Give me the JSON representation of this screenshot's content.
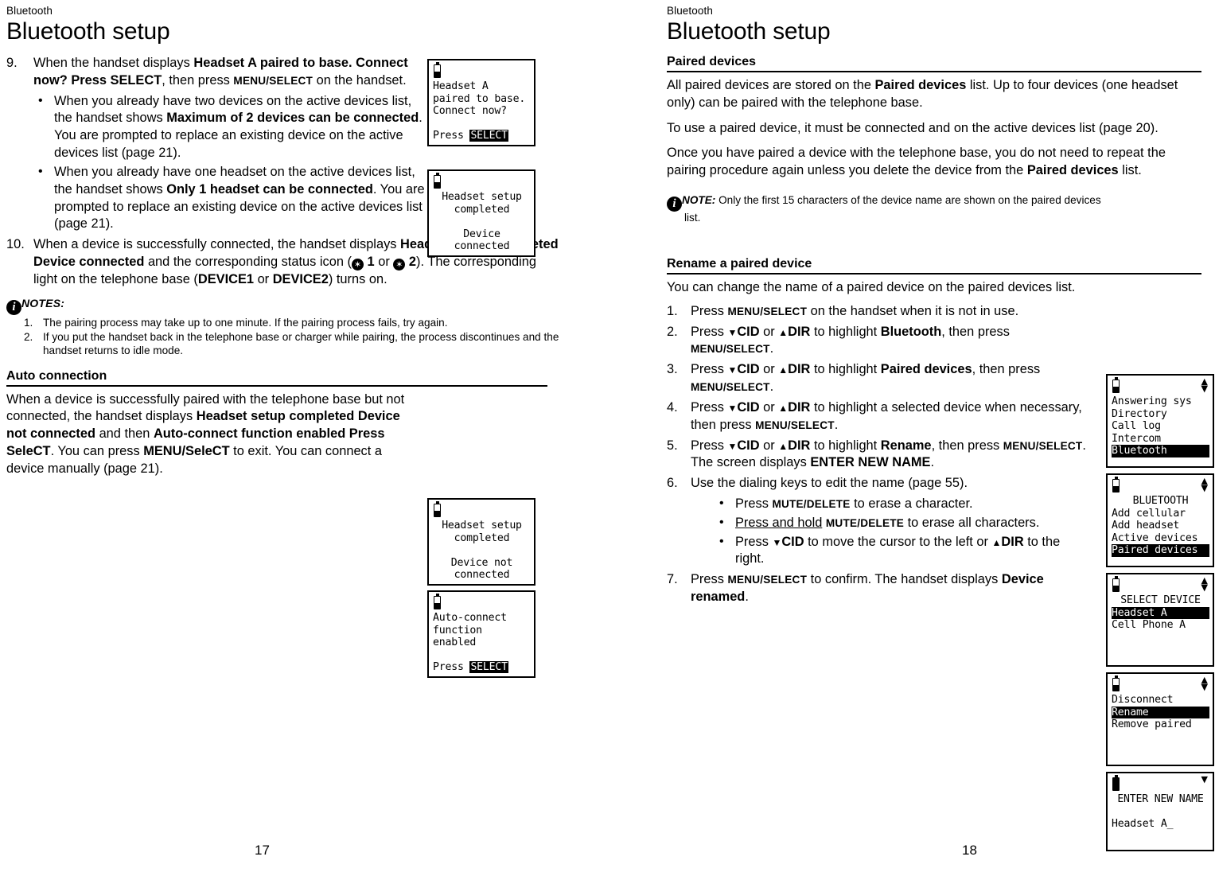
{
  "left_page": {
    "running_head": "Bluetooth",
    "chapter_title": "Bluetooth setup",
    "step9": {
      "num": "9.",
      "t1": "When the handset displays ",
      "b1": "Headset A paired to base. Connect now? Press SELECT",
      "t2": ", then press ",
      "sc1": "MENU/SELECT",
      "t3": " on the handset.",
      "bullets": [
        {
          "t1": "When you already have two devices on the active devices list, the handset shows ",
          "b1": "Maximum of 2 devices can be connected",
          "t2": ". You are prompted to replace an existing device on the active devices list (page 21)."
        },
        {
          "t1": "When you already have one headset on the active devices list, the handset shows ",
          "b1": "Only 1 headset can be connected",
          "t2": ". You are prompted to replace an existing device on the active devices list (page 21)."
        }
      ]
    },
    "step10": {
      "num": "10.",
      "t1": "When a device is successfully connected, the handset displays ",
      "b1": "Headset setup completed Device connected",
      "t2": " and the corresponding status icon (",
      "icon1_num": "1",
      "t3": " or ",
      "icon2_num": "2",
      "t4": "). The corresponding light on the telephone base (",
      "b2": "DEVICE1",
      "t5": " or ",
      "b3": "DEVICE2",
      "t6": ") turns on."
    },
    "notes": {
      "icon": "info-icon",
      "label": "NOTES:",
      "items": [
        {
          "num": "1.",
          "text": "The pairing process may take up to one minute. If the pairing process fails, try again."
        },
        {
          "num": "2.",
          "text": "If you put the handset back in the telephone base or charger while pairing, the process discontinues and the handset returns to idle mode."
        }
      ]
    },
    "auto_connection": {
      "heading": "Auto connection",
      "t1": "When a device is successfully paired with the telephone base but not connected, the handset displays ",
      "b1": "Headset setup completed Device not connected",
      "t2": " and then ",
      "b2": "Auto-connect function enabled Press SeleCT",
      "t3": ". You can press ",
      "b3": "MENU/SeleCT",
      "t4": " to exit. You can connect a device manually (page 21)."
    },
    "page_number": "17",
    "lcds": [
      {
        "name": "lcd-headset-paired",
        "rows": [
          "Headset A",
          "paired to base.",
          "Connect now?",
          "",
          "Press ",
          "SELECT"
        ],
        "line1": "Headset A",
        "line2": "paired to base.",
        "line3": "Connect now?",
        "line5_plain": "Press ",
        "line5_inv": "SELECT"
      },
      {
        "name": "lcd-setup-completed-connected",
        "line1": "Headset setup",
        "line2": "completed",
        "line4": "Device",
        "line5": "connected"
      },
      {
        "name": "lcd-setup-completed-not-connected",
        "line1": "Headset setup",
        "line2": "completed",
        "line4": "Device not",
        "line5": "connected"
      },
      {
        "name": "lcd-auto-connect-enabled",
        "line1": "Auto-connect",
        "line2": "function",
        "line3": "enabled",
        "line5_plain": "Press ",
        "line5_inv": "SELECT"
      }
    ]
  },
  "right_page": {
    "running_head": "Bluetooth",
    "chapter_title": "Bluetooth setup",
    "paired_devices": {
      "heading": "Paired devices",
      "p1_t1": "All paired devices are stored on the ",
      "p1_b1": "Paired devices",
      "p1_t2": " list. Up to four devices (one headset only) can be paired with the telephone base.",
      "p2": "To use a paired device, it must be connected and on the active devices list (page 20).",
      "p3_t1": "Once you have paired a device with the telephone base, you do not need to repeat the pairing procedure again unless you delete the device from the ",
      "p3_b1": "Paired devices",
      "p3_t2": " list.",
      "note_label": "NOTE:",
      "note_text": "Only the first 15 characters of the device name are shown on the paired devices",
      "note_text2": "list."
    },
    "rename": {
      "heading": "Rename a paired device",
      "intro": "You can change the name of a paired device on the paired devices list.",
      "steps": [
        {
          "num": "1.",
          "t1": "Press ",
          "sc1": "MENU/SELECT",
          "t2": " on the handset when it is not in use."
        },
        {
          "num": "2.",
          "t1": "Press ",
          "k1": "CID",
          "t2": " or ",
          "k2": "DIR",
          "t3": " to highlight ",
          "b1": "Bluetooth",
          "t4": ", then press ",
          "sc1": "MENU/SELECT",
          "t5": "."
        },
        {
          "num": "3.",
          "t1": "Press ",
          "k1": "CID",
          "t2": " or ",
          "k2": "DIR",
          "t3": " to highlight ",
          "b1": "Paired devices",
          "t4": ", then press ",
          "sc1": "MENU/SELECT",
          "t5": "."
        },
        {
          "num": "4.",
          "t1": "Press ",
          "k1": "CID",
          "t2": " or ",
          "k2": "DIR",
          "t3": " to highlight a selected device when necessary, then press ",
          "sc1": "MENU/SELECT",
          "t5": "."
        },
        {
          "num": "5.",
          "t1": "Press ",
          "k1": "CID",
          "t2": " or ",
          "k2": "DIR",
          "t3": " to highlight ",
          "b1": "Rename",
          "t4": ", then press ",
          "sc1": "MENU/SELECT",
          "t5": ". The screen displays ",
          "b2": "ENTER NEW NAME",
          "t6": "."
        },
        {
          "num": "6.",
          "t1": "Use the dialing keys to edit the name (page 55)."
        },
        {
          "num": "7.",
          "t1": "Press ",
          "sc1": "MENU/SELECT",
          "t2": " to confirm. The handset displays ",
          "b1": "Device renamed",
          "t3": "."
        }
      ],
      "step6_bullets": [
        {
          "t1": "Press ",
          "sc1": "MUTE/DELETE",
          "t2": " to erase a character."
        },
        {
          "u1": "Press and hold",
          "t1": " ",
          "sc1": "MUTE/DELETE",
          "t2": " to erase all characters."
        },
        {
          "t1": "Press ",
          "k1": "CID",
          "t2": " to move the cursor to the left or ",
          "k2": "DIR",
          "t3": " to the right."
        }
      ]
    },
    "page_number": "18",
    "lcds": [
      {
        "name": "lcd-main-menu",
        "items": [
          "Answering sys",
          "Directory",
          "Call log",
          "Intercom"
        ],
        "selected": "Bluetooth"
      },
      {
        "name": "lcd-bluetooth-menu",
        "title": "BLUETOOTH",
        "items": [
          "Add cellular",
          "Add headset",
          "Active devices"
        ],
        "selected": "Paired devices"
      },
      {
        "name": "lcd-select-device",
        "title": "SELECT DEVICE",
        "selected": "Headset A",
        "items": [
          "Cell Phone A"
        ]
      },
      {
        "name": "lcd-device-options",
        "item_before": "Disconnect",
        "selected": "Rename",
        "item_after": "Remove paired"
      },
      {
        "name": "lcd-enter-new-name",
        "title": "ENTER NEW NAME",
        "value": "Headset A_"
      }
    ]
  }
}
